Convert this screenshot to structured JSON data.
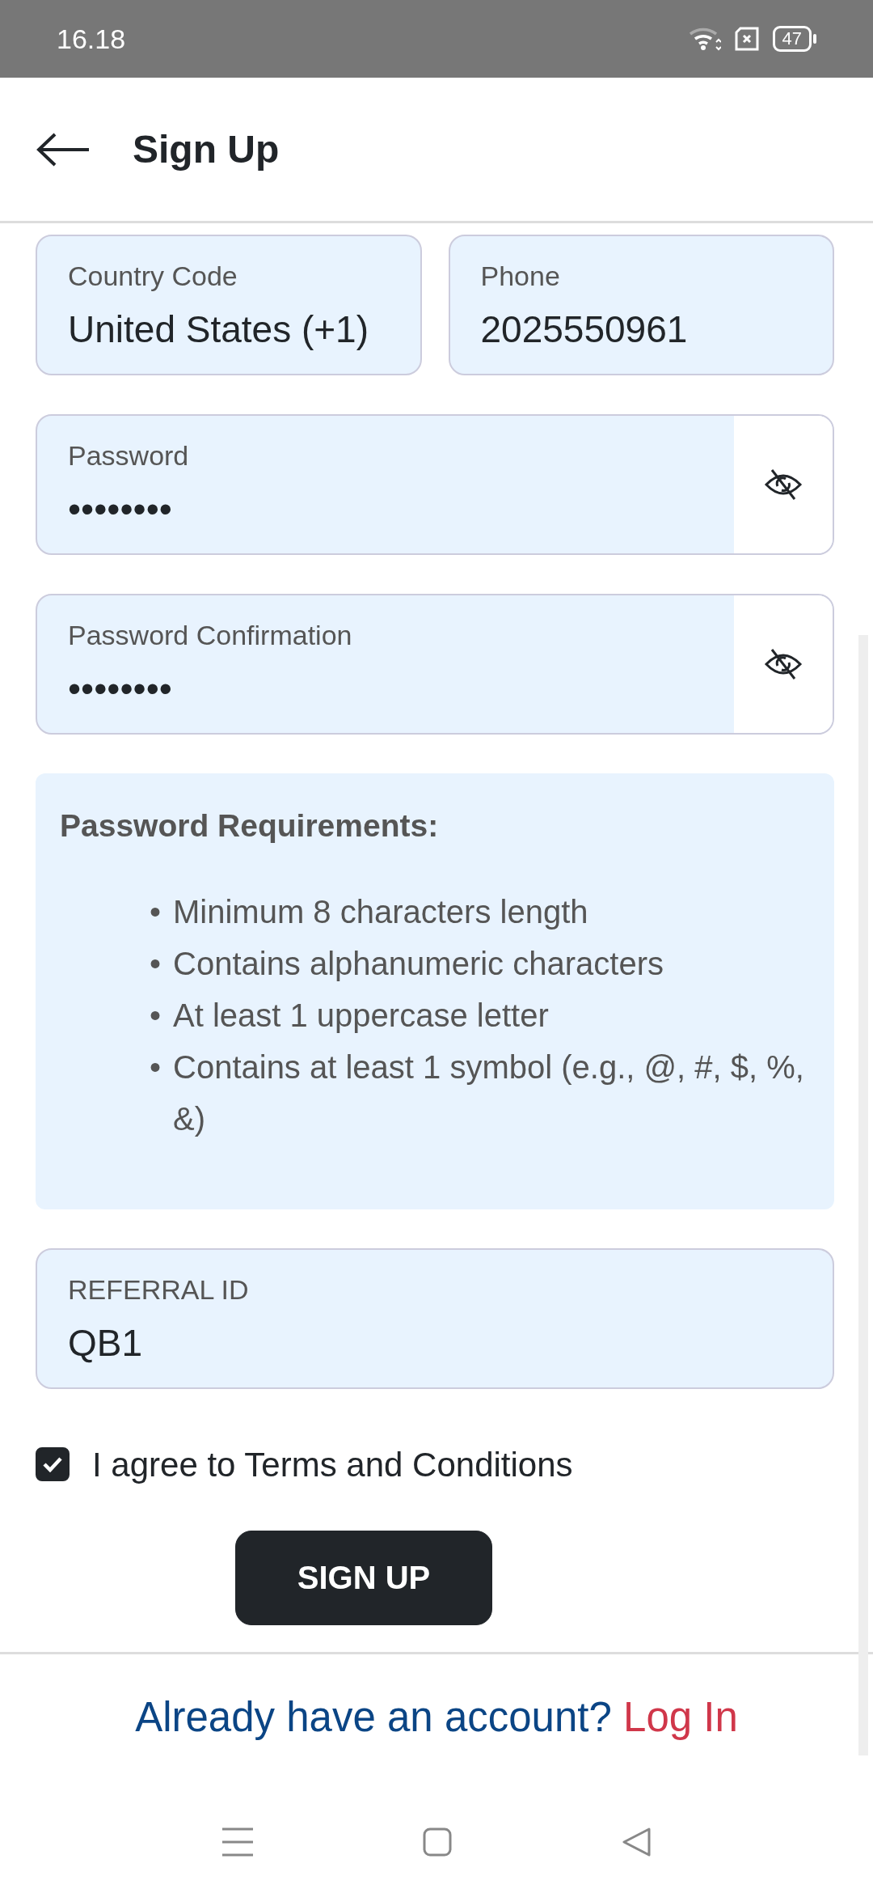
{
  "status_bar": {
    "time": "16.18",
    "battery": "47"
  },
  "header": {
    "title": "Sign Up"
  },
  "fields": [
    {
      "kind": "half",
      "label": "Country Code",
      "value": "United States (+1)"
    },
    {
      "kind": "half",
      "label": "Phone",
      "value": "2025550961"
    },
    {
      "kind": "secret",
      "label": "Password",
      "value": "••••••••",
      "revealed": false
    },
    {
      "kind": "secret",
      "label": "Password Confirmation",
      "value": "••••••••",
      "revealed": false
    }
  ],
  "requirements": {
    "title": "Password Requirements:",
    "items": [
      {
        "bullet": "•",
        "text": "Minimum 8 characters length"
      },
      {
        "bullet": "•",
        "text": "Contains alphanumeric characters"
      },
      {
        "bullet": "•",
        "text": "At least 1 uppercase letter"
      },
      {
        "bullet": "•",
        "text": "Contains at least 1 symbol (e.g., @, #, $, %, &)"
      }
    ]
  },
  "referral": {
    "label": "REFERRAL ID",
    "value": "QB1"
  },
  "terms": {
    "label": "I agree to Terms and Conditions",
    "checked": true
  },
  "submit": {
    "label": "SIGN UP"
  },
  "footer": {
    "question": "Already have an account?",
    "link": "Log In"
  }
}
